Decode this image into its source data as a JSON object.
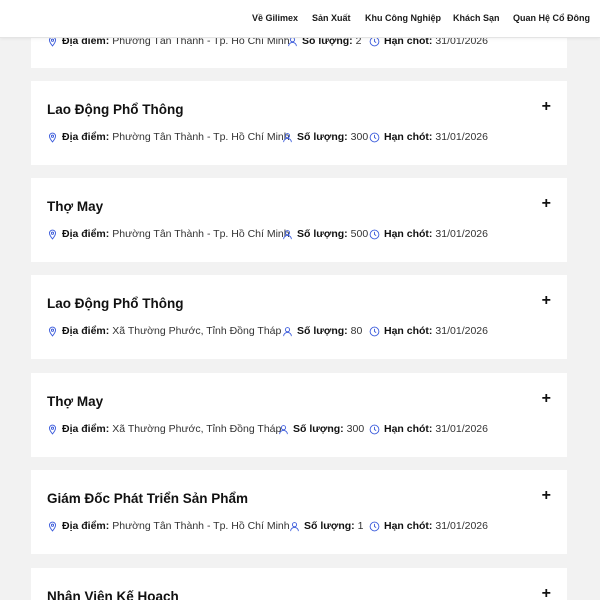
{
  "nav": {
    "items": [
      "Về Gilimex",
      "Sản Xuất",
      "Khu Công Nghiệp",
      "Khách Sạn",
      "Quan Hệ Cổ Đông"
    ]
  },
  "labels": {
    "location": "Địa điểm:",
    "quantity": "Số lượng:",
    "deadline": "Hạn chót:"
  },
  "jobs": [
    {
      "title": "",
      "location": "Phường Tân Thành - Tp. Hồ Chí Minh",
      "quantity": "2",
      "deadline": "31/01/2026"
    },
    {
      "title": "Lao Động Phổ Thông",
      "location": "Phường Tân Thành - Tp. Hồ Chí Minh",
      "quantity": "300",
      "deadline": "31/01/2026"
    },
    {
      "title": "Thợ May",
      "location": "Phường Tân Thành - Tp. Hồ Chí Minh",
      "quantity": "500",
      "deadline": "31/01/2026"
    },
    {
      "title": "Lao Động Phổ Thông",
      "location": "Xã Thường Phước, Tỉnh Đồng Tháp",
      "quantity": "80",
      "deadline": "31/01/2026"
    },
    {
      "title": "Thợ May",
      "location": "Xã Thường Phước, Tỉnh Đồng Tháp",
      "quantity": "300",
      "deadline": "31/01/2026"
    },
    {
      "title": "Giám Đốc Phát Triển Sản Phẩm",
      "location": "Phường Tân Thành - Tp. Hồ Chí Minh",
      "quantity": "1",
      "deadline": "31/01/2026"
    },
    {
      "title": "Nhân Viên Kế Hoạch"
    }
  ],
  "icons": {
    "location": "map-pin-icon",
    "quantity": "user-icon",
    "deadline": "clock-icon",
    "expand": "plus-icon"
  },
  "colors": {
    "icon": "#3b5bdb",
    "background": "#f2f2f2",
    "card": "#ffffff"
  }
}
